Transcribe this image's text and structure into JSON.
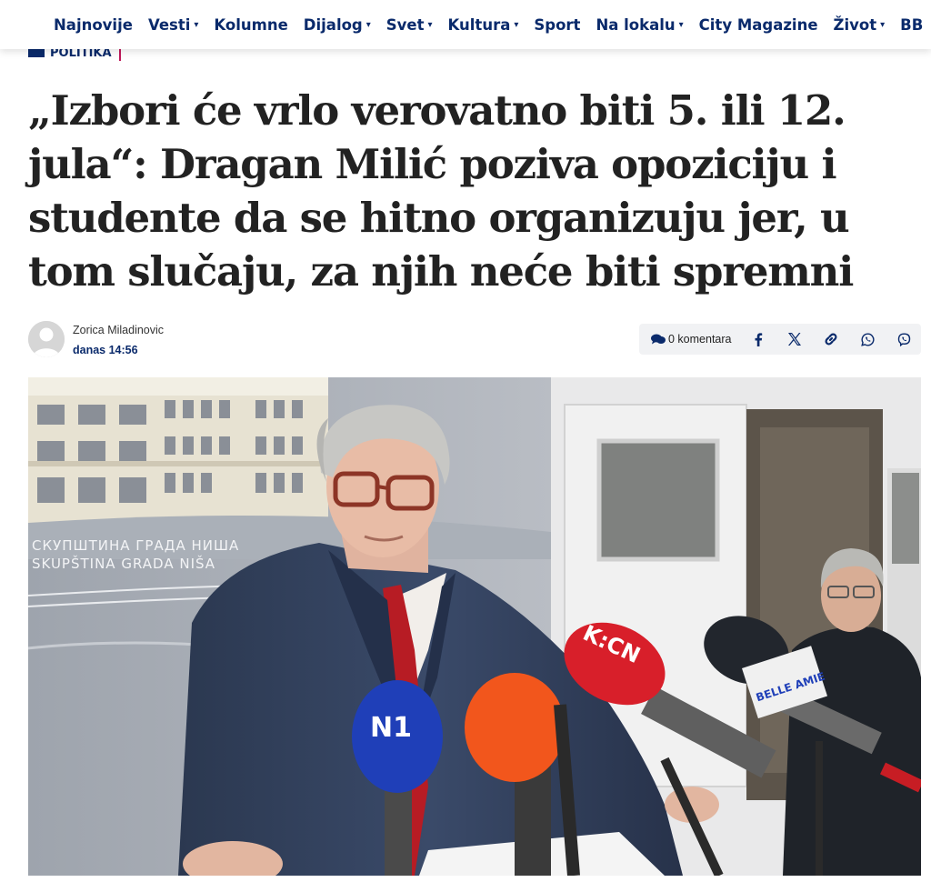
{
  "nav": {
    "items": [
      {
        "label": "Najnovije",
        "dropdown": false
      },
      {
        "label": "Vesti",
        "dropdown": true
      },
      {
        "label": "Kolumne",
        "dropdown": false
      },
      {
        "label": "Dijalog",
        "dropdown": true
      },
      {
        "label": "Svet",
        "dropdown": true
      },
      {
        "label": "Kultura",
        "dropdown": true
      },
      {
        "label": "Sport",
        "dropdown": false
      },
      {
        "label": "Na lokalu",
        "dropdown": true
      },
      {
        "label": "City Magazine",
        "dropdown": false
      },
      {
        "label": "Život",
        "dropdown": true
      },
      {
        "label": "BB",
        "dropdown": false
      }
    ],
    "caret": "▾",
    "icons": {
      "menu": "hamburger-icon",
      "home": "home-icon"
    }
  },
  "article": {
    "category": "Politika",
    "title": "„Izbori će vrlo verovatno biti 5. ili 12. jula“: Dragan Milić poziva opoziciju i studente da se hitno organizuju jer, u tom slučaju, za njih neće biti spremni",
    "author": "Zorica Miladinovic",
    "date": "danas 14:56",
    "comments": "0 komentara",
    "share_icons": [
      "facebook-icon",
      "x-icon",
      "link-icon",
      "whatsapp-icon",
      "viber-icon"
    ],
    "photo_sign_cyrillic": "СКУПШТИНА ГРАДА НИША",
    "photo_sign_latin": "SKUPŠTINA GRADA NIŠA",
    "mic_labels": [
      "N1",
      "K:CN",
      "BELLE AMIE"
    ]
  },
  "colors": {
    "brand": "#0a2a6b",
    "accent": "#c0185a",
    "headline": "#222222"
  }
}
